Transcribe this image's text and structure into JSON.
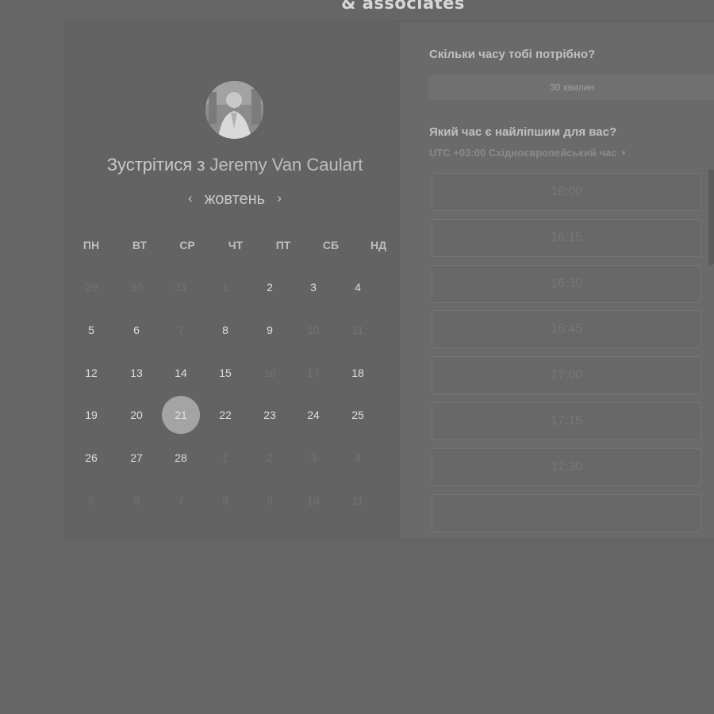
{
  "brand": "& associates",
  "meeting": {
    "prefix": "Зустрітися з ",
    "host": "Jeremy Van Caulart"
  },
  "calendar": {
    "month": "жовтень",
    "prev_icon": "chevron-left-icon",
    "next_icon": "chevron-right-icon",
    "weekdays": [
      "ПН",
      "ВТ",
      "СР",
      "ЧТ",
      "ПТ",
      "СБ",
      "НД"
    ],
    "weeks": [
      [
        {
          "d": "29",
          "m": true
        },
        {
          "d": "30",
          "m": true
        },
        {
          "d": "31",
          "m": true
        },
        {
          "d": "1",
          "m": true
        },
        {
          "d": "2"
        },
        {
          "d": "3"
        },
        {
          "d": "4"
        }
      ],
      [
        {
          "d": "5"
        },
        {
          "d": "6"
        },
        {
          "d": "7",
          "m": true
        },
        {
          "d": "8"
        },
        {
          "d": "9"
        },
        {
          "d": "10",
          "m": true
        },
        {
          "d": "11",
          "m": true
        }
      ],
      [
        {
          "d": "12"
        },
        {
          "d": "13"
        },
        {
          "d": "14"
        },
        {
          "d": "15"
        },
        {
          "d": "16",
          "m": true
        },
        {
          "d": "17",
          "m": true
        },
        {
          "d": "18"
        }
      ],
      [
        {
          "d": "19"
        },
        {
          "d": "20"
        },
        {
          "d": "21",
          "sel": true
        },
        {
          "d": "22"
        },
        {
          "d": "23"
        },
        {
          "d": "24"
        },
        {
          "d": "25"
        }
      ],
      [
        {
          "d": "26"
        },
        {
          "d": "27"
        },
        {
          "d": "28"
        },
        {
          "d": "1",
          "m": true
        },
        {
          "d": "2",
          "m": true
        },
        {
          "d": "3",
          "m": true
        },
        {
          "d": "4",
          "m": true
        }
      ],
      [
        {
          "d": "5",
          "m": true
        },
        {
          "d": "6",
          "m": true
        },
        {
          "d": "7",
          "m": true
        },
        {
          "d": "8",
          "m": true
        },
        {
          "d": "9",
          "m": true
        },
        {
          "d": "10",
          "m": true
        },
        {
          "d": "11",
          "m": true
        }
      ]
    ]
  },
  "duration": {
    "question": "Скільки часу тобі потрібно?",
    "selected": "30 хвилин"
  },
  "time": {
    "question": "Який час є найліпшим для вас?",
    "timezone": "UTC +03:00 Східноєвропейський час",
    "slots": [
      "16:00",
      "16:15",
      "16:30",
      "16:45",
      "17:00",
      "17:15",
      "17:30",
      ""
    ]
  }
}
